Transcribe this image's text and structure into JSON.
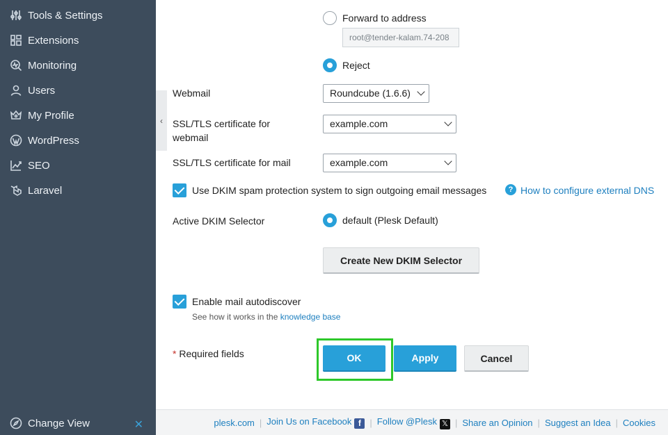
{
  "sidebar": {
    "items": [
      {
        "label": "Tools & Settings",
        "icon": "sliders-icon"
      },
      {
        "label": "Extensions",
        "icon": "extensions-icon"
      },
      {
        "label": "Monitoring",
        "icon": "monitoring-icon"
      },
      {
        "label": "Users",
        "icon": "user-icon"
      },
      {
        "label": "My Profile",
        "icon": "profile-icon"
      },
      {
        "label": "WordPress",
        "icon": "wordpress-icon"
      },
      {
        "label": "SEO",
        "icon": "seo-chart-icon"
      },
      {
        "label": "Laravel",
        "icon": "laravel-icon"
      }
    ],
    "change_view": "Change View"
  },
  "form": {
    "forward_label": "Forward to address",
    "forward_value": "root@tender-kalam.74-208",
    "reject_label": "Reject",
    "webmail_label": "Webmail",
    "webmail_value": "Roundcube (1.6.6)",
    "ssl_webmail_label_1": "SSL/TLS certificate for",
    "ssl_webmail_label_2": "webmail",
    "ssl_webmail_value": "example.com",
    "ssl_mail_label": "SSL/TLS certificate for mail",
    "ssl_mail_value": "example.com",
    "dkim_label": "Use DKIM spam protection system to sign outgoing email messages",
    "dkim_help_link": "How to configure external DNS",
    "dkim_selector_label": "Active DKIM Selector",
    "dkim_selector_value": "default (Plesk Default)",
    "create_selector_button": "Create New DKIM Selector",
    "autodiscover_label": "Enable mail autodiscover",
    "autodiscover_hint": "See how it works in the",
    "autodiscover_link": "knowledge base",
    "required_star": "*",
    "required_text": "Required fields",
    "ok_button": "OK",
    "apply_button": "Apply",
    "cancel_button": "Cancel"
  },
  "footer": {
    "links": [
      "plesk.com",
      "Join Us on Facebook",
      "Follow @Plesk",
      "Share an Opinion",
      "Suggest an Idea",
      "Cookies"
    ]
  },
  "colors": {
    "sidebar_bg": "#3d4c5c",
    "accent": "#28a0d9",
    "highlight": "#2ec82a"
  }
}
